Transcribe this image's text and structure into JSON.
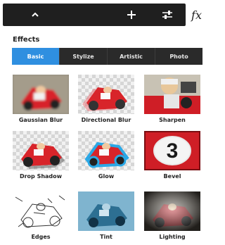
{
  "toolbar": {
    "collapse_icon": "chevron-up-icon",
    "add_icon": "plus-icon",
    "adjust_icon": "sliders-icon",
    "fx_label": "fx"
  },
  "effects": {
    "title": "Effects",
    "tabs": [
      {
        "label": "Basic",
        "active": true
      },
      {
        "label": "Stylize",
        "active": false
      },
      {
        "label": "Artistic",
        "active": false
      },
      {
        "label": "Photo",
        "active": false
      }
    ],
    "items": [
      {
        "label": "Gaussian Blur"
      },
      {
        "label": "Directional Blur"
      },
      {
        "label": "Sharpen"
      },
      {
        "label": "Drop Shadow"
      },
      {
        "label": "Glow"
      },
      {
        "label": "Bevel"
      },
      {
        "label": "Edges"
      },
      {
        "label": "Tint"
      },
      {
        "label": "Lighting"
      }
    ]
  },
  "colors": {
    "accent": "#2f8fe0",
    "toolbar_bg": "#1f1f1f",
    "tabbar_bg": "#2a2a2a"
  }
}
